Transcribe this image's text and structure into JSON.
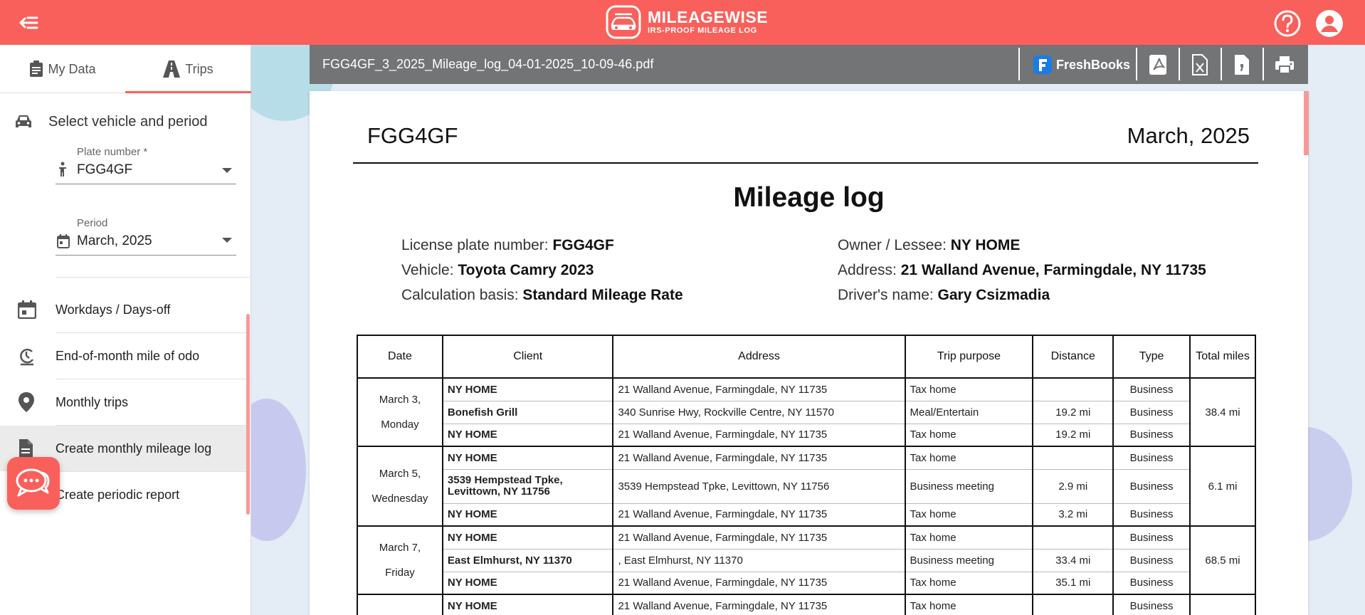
{
  "app": {
    "logo_title": "MILEAGEWISE",
    "logo_subtitle": "IRS-PROOF MILEAGE LOG"
  },
  "colors": {
    "brand": "#f9605b",
    "toolbar": "#737475"
  },
  "sidebar": {
    "tabs": [
      {
        "label": "My Data",
        "icon": "id-card-icon",
        "active": false
      },
      {
        "label": "Trips",
        "icon": "road-icon",
        "active": true
      }
    ],
    "select_heading": "Select vehicle and period",
    "plate_field": {
      "label": "Plate number *",
      "value": "FGG4GF"
    },
    "period_field": {
      "label": "Period",
      "value": "March, 2025"
    },
    "menu": [
      {
        "label": "Workdays / Days-off",
        "icon": "calendar-icon"
      },
      {
        "label": "End-of-month mile of odo",
        "icon": "odometer-icon"
      },
      {
        "label": "Monthly trips",
        "icon": "location-pin-icon"
      },
      {
        "label": "Create monthly mileage log",
        "icon": "document-icon",
        "active": true
      },
      {
        "label": "Create periodic report",
        "icon": "report-icon"
      }
    ]
  },
  "viewer": {
    "filename": "FGG4GF_3_2025_Mileage_log_04-01-2025_10-09-46.pdf",
    "freshbooks_label": "FreshBooks"
  },
  "document": {
    "plate": "FGG4GF",
    "period": "March, 2025",
    "title": "Mileage log",
    "info_left": [
      {
        "label": "License plate number: ",
        "value": "FGG4GF"
      },
      {
        "label": "Vehicle: ",
        "value": "Toyota Camry 2023"
      },
      {
        "label": "Calculation basis: ",
        "value": "Standard Mileage Rate"
      }
    ],
    "info_right": [
      {
        "label": "Owner / Lessee: ",
        "value": "NY HOME"
      },
      {
        "label": "Address: ",
        "value": "21 Walland Avenue, Farmingdale, NY 11735"
      },
      {
        "label": "Driver's name: ",
        "value": "Gary Csizmadia"
      }
    ],
    "columns": [
      "Date",
      "Client",
      "Address",
      "Trip purpose",
      "Distance",
      "Type",
      "Total miles"
    ],
    "days": [
      {
        "date_line1": "March 3,",
        "date_line2": "Monday",
        "total": "38.4 mi",
        "rows": [
          {
            "client": "NY HOME",
            "address": "21 Walland Avenue, Farmingdale, NY 11735",
            "purpose": "Tax home",
            "distance": "",
            "type": "Business"
          },
          {
            "client": "Bonefish Grill",
            "address": "340 Sunrise Hwy, Rockville Centre, NY 11570",
            "purpose": "Meal/Entertain",
            "distance": "19.2 mi",
            "type": "Business"
          },
          {
            "client": "NY HOME",
            "address": "21 Walland Avenue, Farmingdale, NY 11735",
            "purpose": "Tax home",
            "distance": "19.2 mi",
            "type": "Business"
          }
        ]
      },
      {
        "date_line1": "March 5,",
        "date_line2": "Wednesday",
        "total": "6.1 mi",
        "rows": [
          {
            "client": "NY HOME",
            "address": "21 Walland Avenue, Farmingdale, NY 11735",
            "purpose": "Tax home",
            "distance": "",
            "type": "Business"
          },
          {
            "client": "3539 Hempstead Tpke, Levittown, NY 11756",
            "address": "3539 Hempstead Tpke, Levittown, NY 11756",
            "purpose": "Business meeting",
            "distance": "2.9 mi",
            "type": "Business"
          },
          {
            "client": "NY HOME",
            "address": "21 Walland Avenue, Farmingdale, NY 11735",
            "purpose": "Tax home",
            "distance": "3.2 mi",
            "type": "Business"
          }
        ]
      },
      {
        "date_line1": "March 7,",
        "date_line2": "Friday",
        "total": "68.5 mi",
        "rows": [
          {
            "client": "NY HOME",
            "address": "21 Walland Avenue, Farmingdale, NY 11735",
            "purpose": "Tax home",
            "distance": "",
            "type": "Business"
          },
          {
            "client": "East Elmhurst, NY 11370",
            "address": ", East Elmhurst, NY 11370",
            "purpose": "Business meeting",
            "distance": "33.4 mi",
            "type": "Business"
          },
          {
            "client": "NY HOME",
            "address": "21 Walland Avenue, Farmingdale, NY 11735",
            "purpose": "Tax home",
            "distance": "35.1 mi",
            "type": "Business"
          }
        ]
      },
      {
        "date_line1": "",
        "date_line2": "",
        "total": "",
        "rows": [
          {
            "client": "NY HOME",
            "address": "21 Walland Avenue, Farmingdale, NY 11735",
            "purpose": "Tax home",
            "distance": "",
            "type": "Business"
          }
        ]
      }
    ]
  }
}
